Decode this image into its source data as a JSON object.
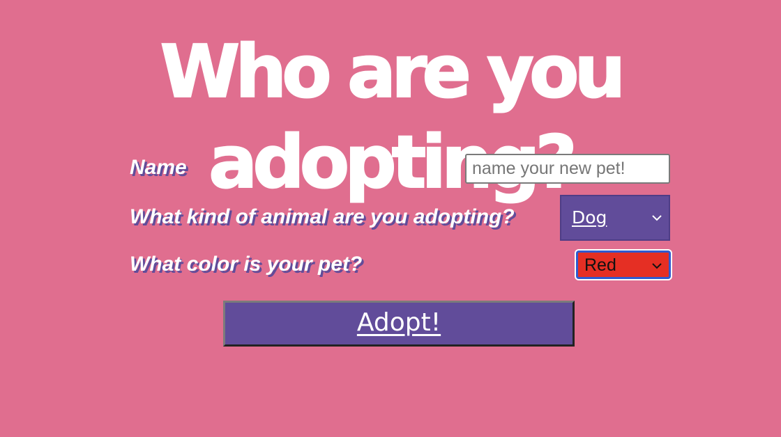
{
  "page": {
    "title": "Who are you adopting?"
  },
  "form": {
    "name_label": "Name",
    "name_placeholder": "name your new pet!",
    "name_value": "",
    "animal_label": "What kind of animal are you adopting?",
    "animal_selected": "Dog",
    "color_label": "What color is your pet?",
    "color_selected": "Red",
    "submit_label": "Adopt!"
  },
  "icons": {
    "animal_select": "chevron-down-icon",
    "color_select": "chevron-down-icon"
  },
  "colors": {
    "background": "#e06e8f",
    "accent_purple": "#614c9a",
    "text_white": "#ffffff",
    "color_select_red": "#e52f24",
    "focus_blue": "#2f5ad0"
  }
}
